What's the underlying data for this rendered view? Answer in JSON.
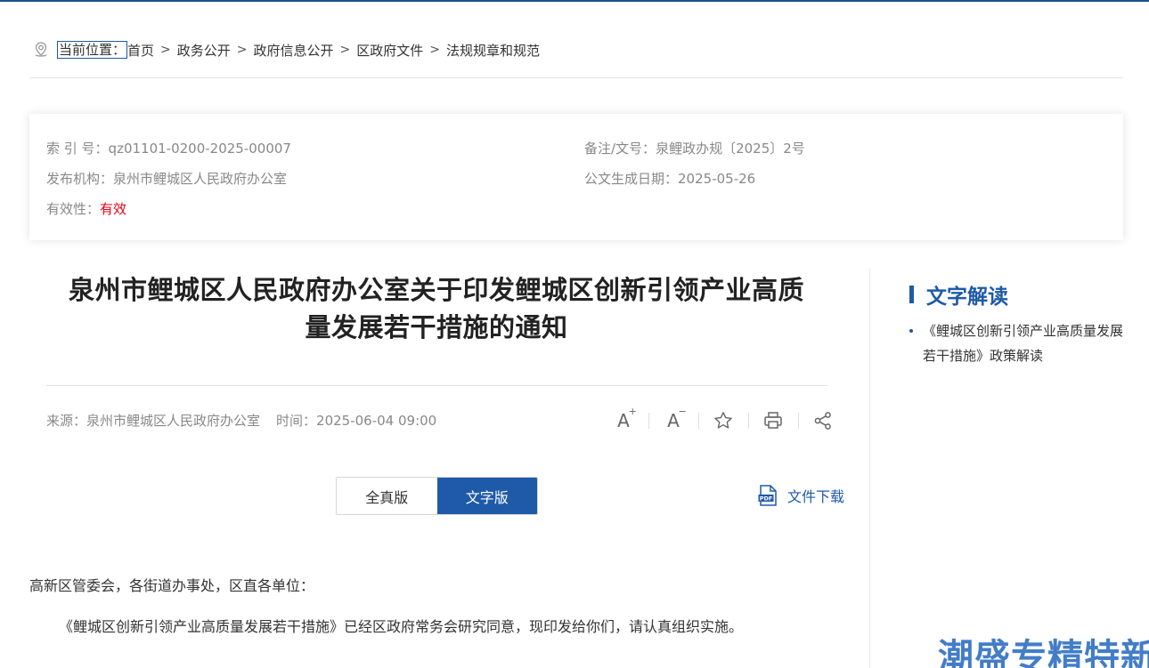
{
  "breadcrumb": {
    "lead": "当前位置：",
    "items": [
      "首页",
      "政务公开",
      "政府信息公开",
      "区政府文件",
      "法规规章和规范"
    ],
    "separator": ">"
  },
  "meta": {
    "index_label": "索 引 号：",
    "index_value": "qz01101-0200-2025-00007",
    "doc_no_label": "备注/文号：",
    "doc_no_value": "泉鲤政办规〔2025〕2号",
    "publisher_label": "发布机构：",
    "publisher_value": "泉州市鲤城区人民政府办公室",
    "date_label": "公文生成日期：",
    "date_value": "2025-05-26",
    "validity_label": "有效性：",
    "validity_value": "有效"
  },
  "title": {
    "line1": "泉州市鲤城区人民政府办公室关于印发鲤城区创新引领产业高质",
    "line2": "量发展若干措施的通知"
  },
  "source": {
    "source_label": "来源：",
    "source_value": "泉州市鲤城区人民政府办公室",
    "time_label": "时间：",
    "time_value": "2025-06-04 09:00"
  },
  "tools": {
    "font_large": "A",
    "font_large_mark": "+",
    "font_small": "A",
    "font_small_mark": "−"
  },
  "tabs": {
    "full": "全真版",
    "text": "文字版"
  },
  "download": {
    "label": "文件下载"
  },
  "body": {
    "salutation": "高新区管委会，各街道办事处，区直各单位：",
    "paragraph": "《鲤城区创新引领产业高质量发展若干措施》已经区政府常务会研究同意，现印发给你们，请认真组织实施。"
  },
  "sidebar": {
    "title": "文字解读",
    "items": [
      {
        "label": "《鲤城区创新引领产业高质量发展若干措施》政策解读"
      }
    ]
  },
  "watermark": "潮盛专精特新",
  "colors": {
    "accent": "#1e5aa8",
    "valid": "#e60012",
    "muted": "#888888"
  }
}
